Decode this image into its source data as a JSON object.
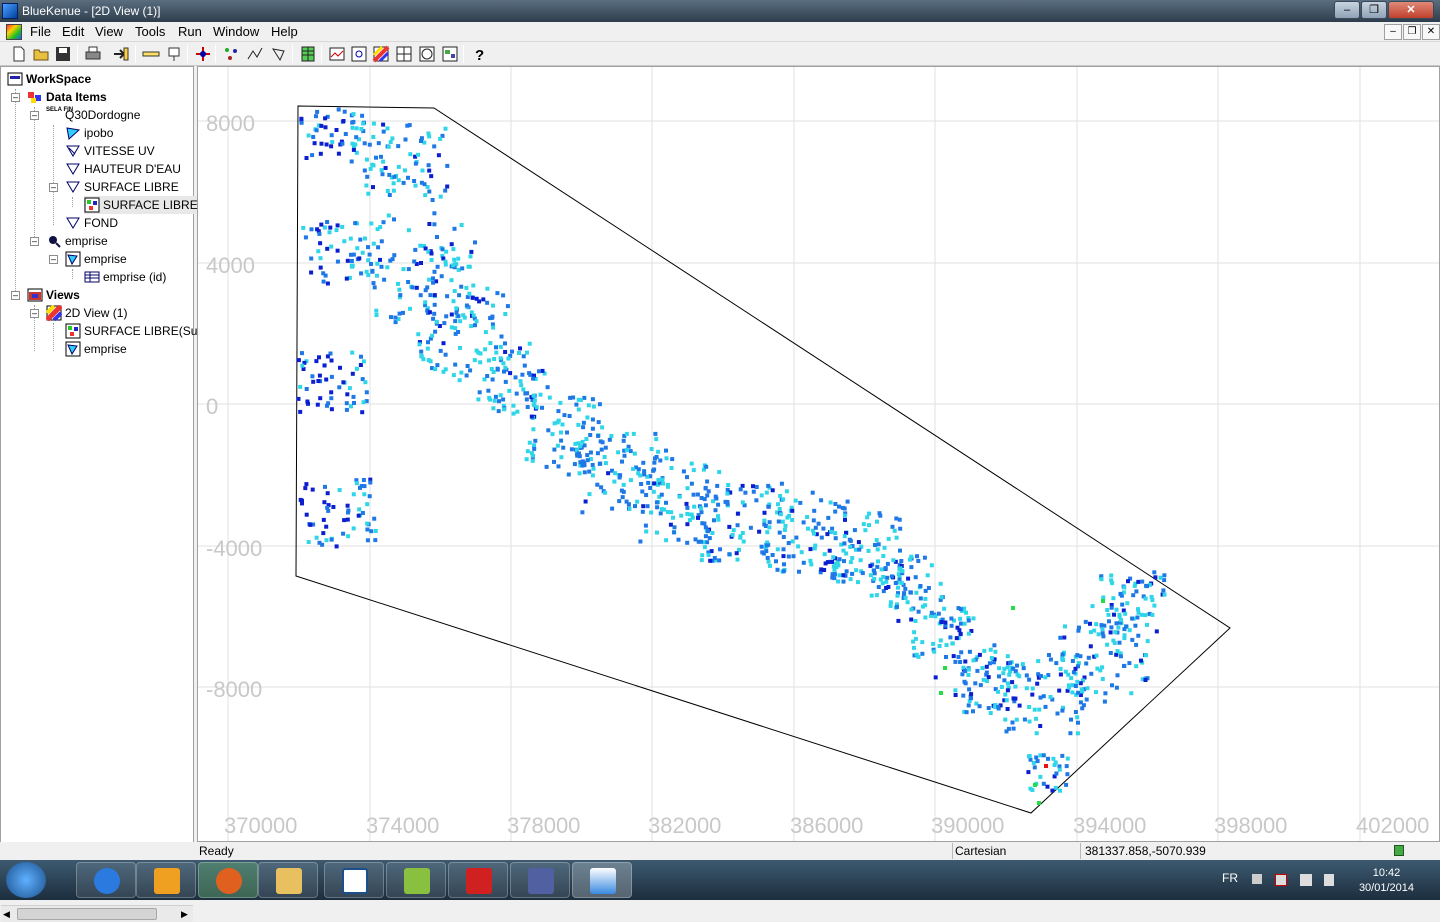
{
  "window": {
    "title": "BlueKenue - [2D View (1)]"
  },
  "menu": {
    "items": [
      "File",
      "Edit",
      "View",
      "Tools",
      "Run",
      "Window",
      "Help"
    ]
  },
  "toolbar": {
    "icons": [
      "new-file-icon",
      "open-folder-icon",
      "save-icon",
      "print-icon",
      "import-icon",
      "ruler-icon",
      "probe-icon",
      "crosshair-icon",
      "mesh-icon",
      "polyline-icon",
      "polygon-icon",
      "grid-table-icon",
      "profile-icon",
      "zoom-extents-icon",
      "colour-scale-icon",
      "tile-icon",
      "globe-icon",
      "properties-icon",
      "help-icon"
    ]
  },
  "tree": {
    "workspace": "WorkSpace",
    "data_items": "Data Items",
    "q30": "Q30Dordogne",
    "ipobo": "ipobo",
    "vitesse": "VITESSE UV",
    "hauteur": "HAUTEUR D'EAU",
    "surface": "SURFACE LIBRE",
    "surface_sub": "SURFACE LIBRE(S",
    "fond": "FOND",
    "emprise1": "emprise",
    "emprise2": "emprise",
    "emprise_id": "emprise (id)",
    "views": "Views",
    "view2d": "2D View (1)",
    "view_surface": "SURFACE LIBRE(Sub",
    "view_emprise": "emprise",
    "icon_mark": "SELA FIN"
  },
  "plot": {
    "y_labels": [
      "8000",
      "4000",
      "0",
      "-4000",
      "-8000"
    ],
    "x_labels": [
      "370000",
      "374000",
      "378000",
      "382000",
      "386000",
      "390000",
      "394000",
      "398000",
      "402000"
    ],
    "colors": {
      "deep": "#0b1fd0",
      "mid": "#1e78e6",
      "light": "#2fd6e8",
      "green": "#22dd44",
      "red": "#ee1111"
    }
  },
  "status": {
    "ready": "Ready",
    "coord_system": "Cartesian",
    "cursor": "381337.858,-5070.939"
  },
  "taskbar": {
    "lang": "FR",
    "time": "10:42",
    "date": "30/01/2014"
  }
}
